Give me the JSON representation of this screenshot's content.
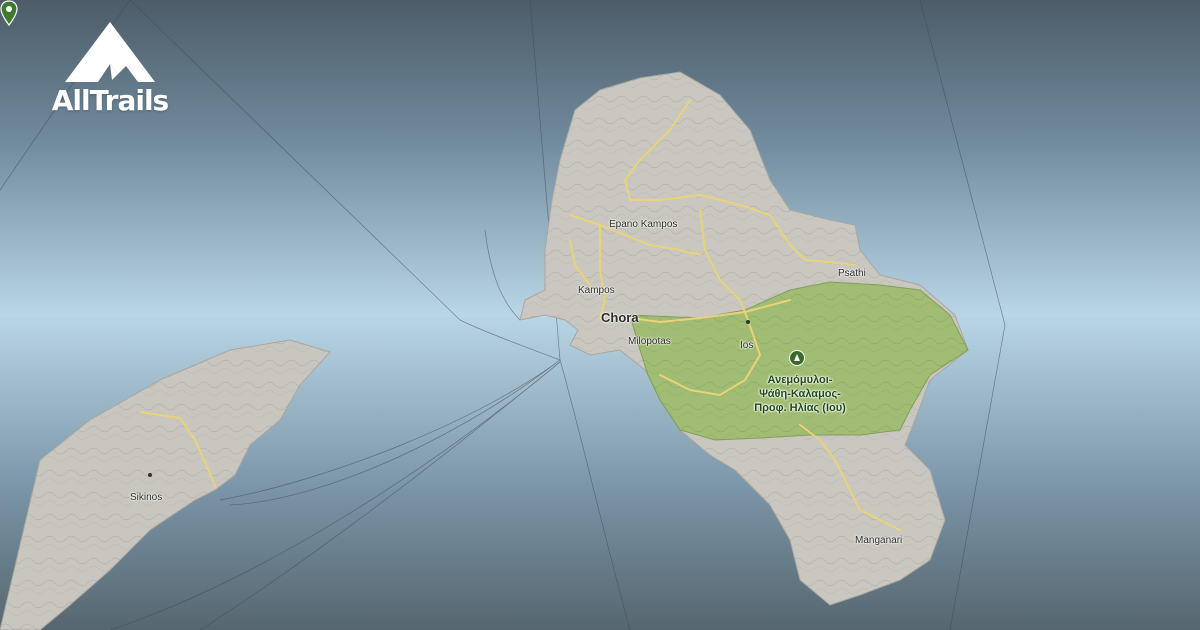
{
  "brand": {
    "name": "AllTrails",
    "logo_icon": "mountain-icon"
  },
  "colors": {
    "water": "#9cc3da",
    "land": "#c9c7c0",
    "park": "#9ebd6e",
    "trail": "#e8d27a",
    "pin": "#3c7a2c"
  },
  "map": {
    "places": [
      {
        "id": "epano-kampos",
        "name": "Epano Kampos"
      },
      {
        "id": "kampos",
        "name": "Kampos"
      },
      {
        "id": "chora",
        "name": "Chora"
      },
      {
        "id": "milopotas",
        "name": "Milopotas"
      },
      {
        "id": "ios",
        "name": "Ios"
      },
      {
        "id": "psathi",
        "name": "Psathi"
      },
      {
        "id": "sikinos",
        "name": "Sikinos"
      },
      {
        "id": "manganari",
        "name": "Manganari"
      }
    ],
    "park": {
      "name_line1": "Ανεμόμυλοι-",
      "name_line2": "Ψάθη-Καλαμος-",
      "name_line3": "Προφ. Ηλίας (Ιου)",
      "icon": "park-tree-icon"
    },
    "selected_pin_icon": "location-pin-icon"
  }
}
